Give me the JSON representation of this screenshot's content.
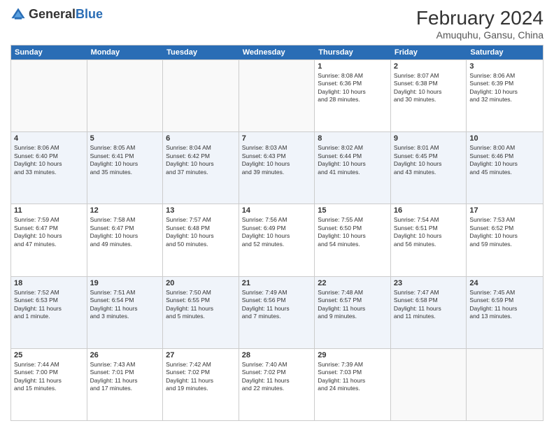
{
  "header": {
    "logo_general": "General",
    "logo_blue": "Blue",
    "month_title": "February 2024",
    "location": "Amuquhu, Gansu, China"
  },
  "days_of_week": [
    "Sunday",
    "Monday",
    "Tuesday",
    "Wednesday",
    "Thursday",
    "Friday",
    "Saturday"
  ],
  "weeks": [
    [
      {
        "day": "",
        "info": ""
      },
      {
        "day": "",
        "info": ""
      },
      {
        "day": "",
        "info": ""
      },
      {
        "day": "",
        "info": ""
      },
      {
        "day": "1",
        "info": "Sunrise: 8:08 AM\nSunset: 6:36 PM\nDaylight: 10 hours\nand 28 minutes."
      },
      {
        "day": "2",
        "info": "Sunrise: 8:07 AM\nSunset: 6:38 PM\nDaylight: 10 hours\nand 30 minutes."
      },
      {
        "day": "3",
        "info": "Sunrise: 8:06 AM\nSunset: 6:39 PM\nDaylight: 10 hours\nand 32 minutes."
      }
    ],
    [
      {
        "day": "4",
        "info": "Sunrise: 8:06 AM\nSunset: 6:40 PM\nDaylight: 10 hours\nand 33 minutes."
      },
      {
        "day": "5",
        "info": "Sunrise: 8:05 AM\nSunset: 6:41 PM\nDaylight: 10 hours\nand 35 minutes."
      },
      {
        "day": "6",
        "info": "Sunrise: 8:04 AM\nSunset: 6:42 PM\nDaylight: 10 hours\nand 37 minutes."
      },
      {
        "day": "7",
        "info": "Sunrise: 8:03 AM\nSunset: 6:43 PM\nDaylight: 10 hours\nand 39 minutes."
      },
      {
        "day": "8",
        "info": "Sunrise: 8:02 AM\nSunset: 6:44 PM\nDaylight: 10 hours\nand 41 minutes."
      },
      {
        "day": "9",
        "info": "Sunrise: 8:01 AM\nSunset: 6:45 PM\nDaylight: 10 hours\nand 43 minutes."
      },
      {
        "day": "10",
        "info": "Sunrise: 8:00 AM\nSunset: 6:46 PM\nDaylight: 10 hours\nand 45 minutes."
      }
    ],
    [
      {
        "day": "11",
        "info": "Sunrise: 7:59 AM\nSunset: 6:47 PM\nDaylight: 10 hours\nand 47 minutes."
      },
      {
        "day": "12",
        "info": "Sunrise: 7:58 AM\nSunset: 6:47 PM\nDaylight: 10 hours\nand 49 minutes."
      },
      {
        "day": "13",
        "info": "Sunrise: 7:57 AM\nSunset: 6:48 PM\nDaylight: 10 hours\nand 50 minutes."
      },
      {
        "day": "14",
        "info": "Sunrise: 7:56 AM\nSunset: 6:49 PM\nDaylight: 10 hours\nand 52 minutes."
      },
      {
        "day": "15",
        "info": "Sunrise: 7:55 AM\nSunset: 6:50 PM\nDaylight: 10 hours\nand 54 minutes."
      },
      {
        "day": "16",
        "info": "Sunrise: 7:54 AM\nSunset: 6:51 PM\nDaylight: 10 hours\nand 56 minutes."
      },
      {
        "day": "17",
        "info": "Sunrise: 7:53 AM\nSunset: 6:52 PM\nDaylight: 10 hours\nand 59 minutes."
      }
    ],
    [
      {
        "day": "18",
        "info": "Sunrise: 7:52 AM\nSunset: 6:53 PM\nDaylight: 11 hours\nand 1 minute."
      },
      {
        "day": "19",
        "info": "Sunrise: 7:51 AM\nSunset: 6:54 PM\nDaylight: 11 hours\nand 3 minutes."
      },
      {
        "day": "20",
        "info": "Sunrise: 7:50 AM\nSunset: 6:55 PM\nDaylight: 11 hours\nand 5 minutes."
      },
      {
        "day": "21",
        "info": "Sunrise: 7:49 AM\nSunset: 6:56 PM\nDaylight: 11 hours\nand 7 minutes."
      },
      {
        "day": "22",
        "info": "Sunrise: 7:48 AM\nSunset: 6:57 PM\nDaylight: 11 hours\nand 9 minutes."
      },
      {
        "day": "23",
        "info": "Sunrise: 7:47 AM\nSunset: 6:58 PM\nDaylight: 11 hours\nand 11 minutes."
      },
      {
        "day": "24",
        "info": "Sunrise: 7:45 AM\nSunset: 6:59 PM\nDaylight: 11 hours\nand 13 minutes."
      }
    ],
    [
      {
        "day": "25",
        "info": "Sunrise: 7:44 AM\nSunset: 7:00 PM\nDaylight: 11 hours\nand 15 minutes."
      },
      {
        "day": "26",
        "info": "Sunrise: 7:43 AM\nSunset: 7:01 PM\nDaylight: 11 hours\nand 17 minutes."
      },
      {
        "day": "27",
        "info": "Sunrise: 7:42 AM\nSunset: 7:02 PM\nDaylight: 11 hours\nand 19 minutes."
      },
      {
        "day": "28",
        "info": "Sunrise: 7:40 AM\nSunset: 7:02 PM\nDaylight: 11 hours\nand 22 minutes."
      },
      {
        "day": "29",
        "info": "Sunrise: 7:39 AM\nSunset: 7:03 PM\nDaylight: 11 hours\nand 24 minutes."
      },
      {
        "day": "",
        "info": ""
      },
      {
        "day": "",
        "info": ""
      }
    ]
  ]
}
